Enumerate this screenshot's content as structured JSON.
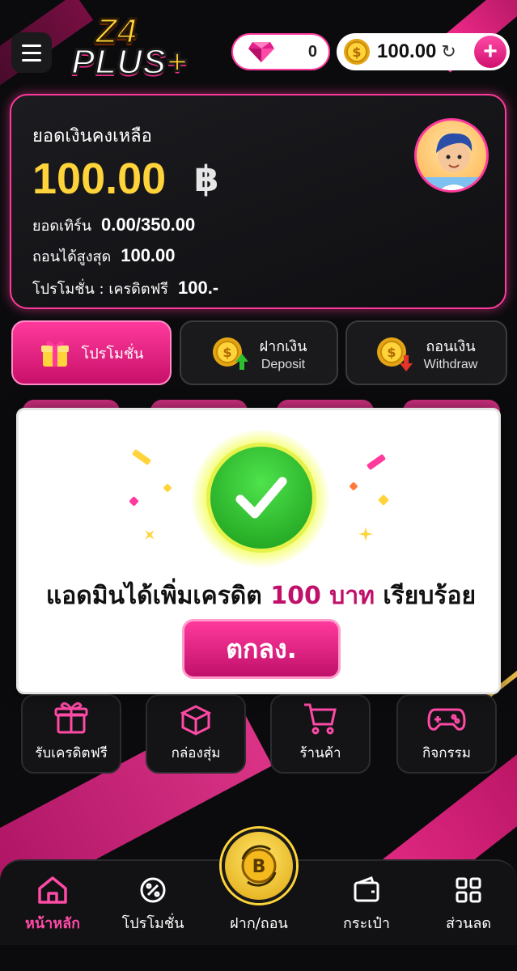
{
  "header": {
    "logo_line1": "Z4",
    "logo_line2": "PLUS",
    "logo_plus": "+",
    "gems": "0",
    "credit": "100.00",
    "add_label": "+"
  },
  "balance": {
    "title": "ยอดเงินคงเหลือ",
    "amount": "100.00",
    "currency": "฿",
    "turnover_label": "ยอดเทิร์น",
    "turnover_value": "0.00/350.00",
    "max_withdraw_label": "ถอนได้สูงสุด",
    "max_withdraw_value": "100.00",
    "promo_label": "โปรโมชั่น : เครดิตฟรี",
    "promo_value": "100.-"
  },
  "actions": {
    "promo": "โปรโมชั่น",
    "deposit_th": "ฝากเงิน",
    "deposit_en": "Deposit",
    "withdraw_th": "ถอนเงิน",
    "withdraw_en": "Withdraw"
  },
  "features": [
    {
      "label": "รับเครดิตฟรี",
      "icon": "gift-icon"
    },
    {
      "label": "กล่องสุ่ม",
      "icon": "box-icon"
    },
    {
      "label": "ร้านค้า",
      "icon": "cart-icon"
    },
    {
      "label": "กิจกรรม",
      "icon": "gamepad-icon"
    }
  ],
  "modal": {
    "msg_before": "แอดมินได้เพิ่มเครดิต",
    "msg_highlight": "100 บาท",
    "msg_after": "เรียบร้อย",
    "ok_label": "ตกลง."
  },
  "nav": {
    "home": "หน้าหลัก",
    "promotion": "โปรโมชั่น",
    "deposit_withdraw": "ฝาก/ถอน",
    "wallet": "กระเป๋า",
    "discount": "ส่วนลด"
  },
  "colors": {
    "accent": "#ff3a9c",
    "gold": "#ffd43a",
    "success": "#2fbf2f"
  }
}
